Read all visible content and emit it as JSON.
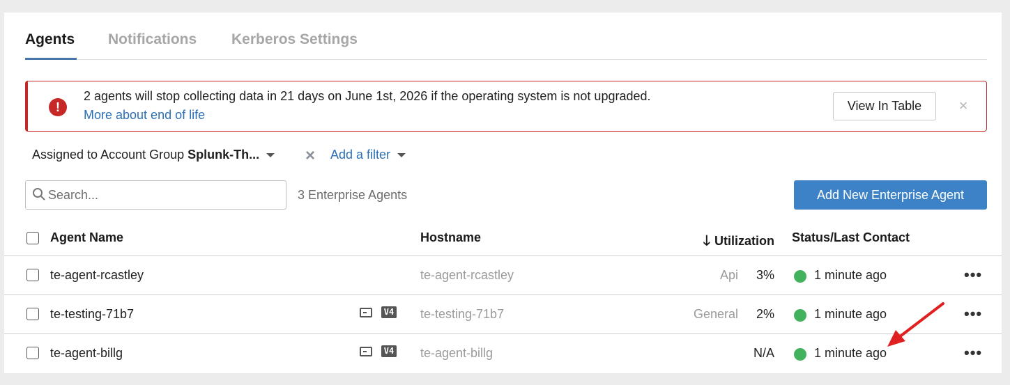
{
  "tabs": [
    {
      "label": "Agents",
      "active": true
    },
    {
      "label": "Notifications",
      "active": false
    },
    {
      "label": "Kerberos Settings",
      "active": false
    }
  ],
  "banner": {
    "icon": "exclamation-icon",
    "message": "2 agents will stop collecting data in 21 days on June 1st, 2026 if the operating system is not upgraded.",
    "link": "More about end of life",
    "view_button": "View In Table",
    "close": "×",
    "color": "#c62828"
  },
  "filter": {
    "label": "Assigned to Account Group ",
    "value": "Splunk-Th...",
    "clear_icon": "×",
    "add_filter": "Add a filter"
  },
  "search": {
    "placeholder": "Search...",
    "value": ""
  },
  "agent_count": "3 Enterprise Agents",
  "add_button": "Add New Enterprise Agent",
  "table": {
    "headers": {
      "name": "Agent Name",
      "hostname": "Hostname",
      "sort_arrow": "🡓",
      "utilization": "Utilization",
      "status": "Status/Last Contact"
    },
    "rows": [
      {
        "name": "te-agent-rcastley",
        "hostname": "te-agent-rcastley",
        "type": "Api",
        "utilization": "3%",
        "status": "1 minute ago",
        "has_icons": false
      },
      {
        "name": "te-testing-71b7",
        "hostname": "te-testing-71b7",
        "type": "General",
        "utilization": "2%",
        "status": "1 minute ago",
        "has_icons": true
      },
      {
        "name": "te-agent-billg",
        "hostname": "te-agent-billg",
        "type": "",
        "utilization": "N/A",
        "status": "1 minute ago",
        "has_icons": true
      }
    ],
    "v4_label": "V4",
    "more_label": "•••"
  },
  "colors": {
    "accent": "#3d82c6",
    "link": "#2a6fb8",
    "status_ok": "#43b25f",
    "annotation_arrow": "#e02020"
  }
}
